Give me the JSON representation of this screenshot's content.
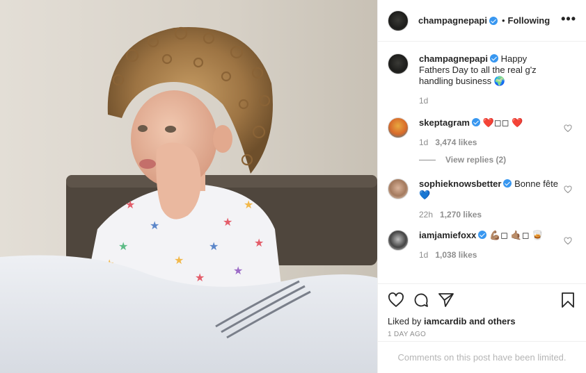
{
  "post": {
    "author": "champagnepapi",
    "follow_status": "Following",
    "more_label": "•••",
    "caption": "Happy Fathers Day to all the real g'z handling business 🌍",
    "caption_time": "1d"
  },
  "comments": [
    {
      "username": "skeptagram",
      "text": "❤️◻◻   ❤️",
      "time": "1d",
      "likes": "3,474 likes",
      "view_replies": "View replies (2)"
    },
    {
      "username": "sophieknowsbetter",
      "text": "Bonne fête 💙",
      "time": "22h",
      "likes": "1,270 likes"
    },
    {
      "username": "iamjamiefoxx",
      "text": "💪🏽◻   🤙🏽◻   🥃",
      "time": "1d",
      "likes": "1,038 likes"
    }
  ],
  "footer": {
    "liked_prefix": "Liked by",
    "liked_user": "iamcardib",
    "liked_suffix": "and others",
    "timestamp": "1 DAY AGO",
    "comments_limited": "Comments on this post have been limited."
  },
  "icons": [
    "heart-icon",
    "comment-icon",
    "share-icon",
    "bookmark-icon",
    "verified-icon"
  ],
  "colors": {
    "verified": "#3897f0",
    "muted": "#8e8e8e",
    "text": "#262626",
    "divider": "#efefef"
  }
}
